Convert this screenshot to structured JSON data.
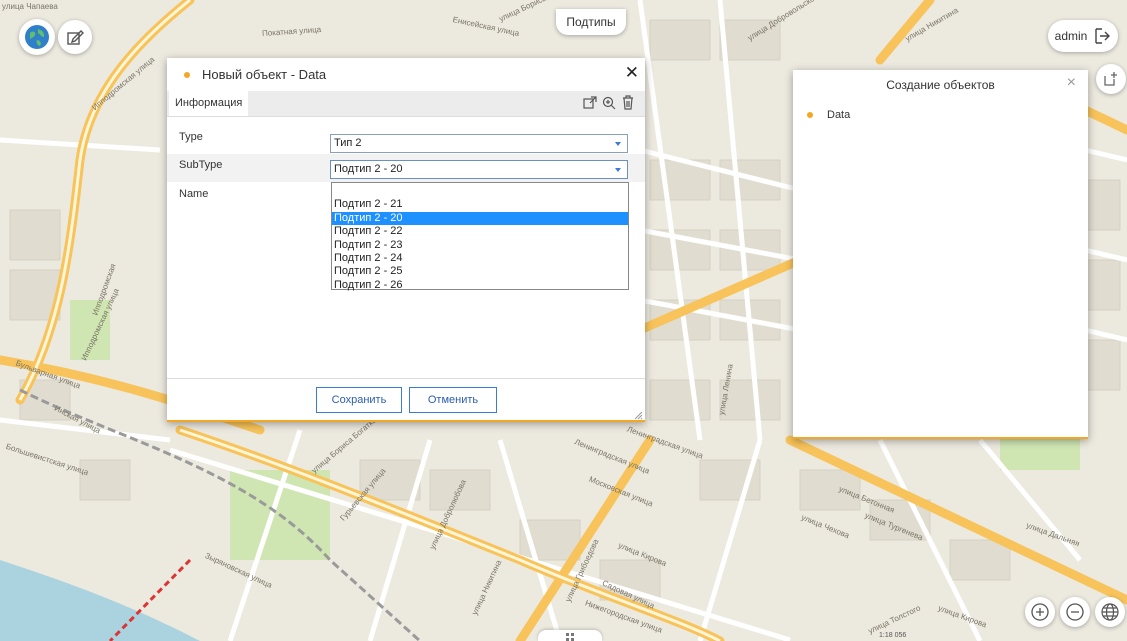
{
  "map": {
    "tab_label": "Подтипы",
    "scale_text": "1:18 056",
    "street_labels": [
      "улица Чапаева",
      "Покатная улица",
      "Енисейская улица",
      "улица Бориса",
      "улица Добровольского",
      "улица Никитина",
      "Ипподромская улица",
      "Ипподромская улица",
      "улица Даурская",
      "Ипподромская",
      "Бульварная улица",
      "улица Ленина",
      "Ленинградская улица",
      "Московская улица",
      "улица Кирова",
      "Большевистская улица",
      "улица Бориса Богаткова",
      "Зыряновская улица",
      "Гурьевская улица",
      "улица Добролюбова",
      "улица Никитина",
      "улица Грибоедова",
      "Садовая улица",
      "Нижегородская улица",
      "улица Бетонная",
      "улица Чехова",
      "улица Тургенева",
      "улица Толстого",
      "улица Дальняя",
      "улица Кирова",
      "Инская улица",
      "Ленинградская улица"
    ]
  },
  "top_left": {
    "globe_icon": "globe-icon",
    "edit_icon": "edit-layer-icon"
  },
  "user": {
    "name": "admin",
    "logout_icon": "logout-icon"
  },
  "right_tools": {
    "add_feature_icon": "add-feature-icon"
  },
  "dialog": {
    "title": "Новый объект - Data",
    "close": "✕",
    "tab": "Информация",
    "toolbar_icons": [
      "pick-geometry-icon",
      "zoom-to-icon",
      "trash-icon"
    ],
    "fields": [
      {
        "label": "Type",
        "value": "Тип 2"
      },
      {
        "label": "SubType",
        "value": "Подтип 2 - 20"
      },
      {
        "label": "Name",
        "value": ""
      }
    ],
    "dropdown_options": [
      "",
      "Подтип 2 - 21",
      "Подтип 2 - 20",
      "Подтип 2 - 22",
      "Подтип 2 - 23",
      "Подтип 2 - 24",
      "Подтип 2 - 25",
      "Подтип 2 - 26"
    ],
    "selected_option": "Подтип 2 - 20",
    "save_label": "Сохранить",
    "cancel_label": "Отменить"
  },
  "create_panel": {
    "title": "Создание объектов",
    "close": "×",
    "items": [
      {
        "label": "Data"
      }
    ]
  },
  "zoom": {
    "in_icon": "zoom-in-icon",
    "out_icon": "zoom-out-icon",
    "globe_icon": "world-icon"
  },
  "colors": {
    "accent": "#3a7bd5",
    "marker": "#f5a623",
    "selected": "#1e90ff",
    "road": "#f7c35a",
    "water": "#aad3df"
  }
}
